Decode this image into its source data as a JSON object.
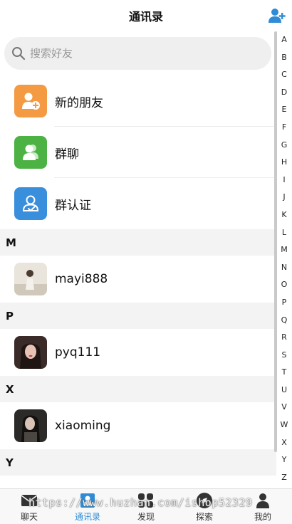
{
  "header": {
    "title": "通讯录"
  },
  "search": {
    "placeholder": "搜索好友"
  },
  "functions": [
    {
      "label": "新的朋友",
      "color": "#f39a42",
      "icon": "new-friend-icon"
    },
    {
      "label": "群聊",
      "color": "#4cb244",
      "icon": "group-chat-icon"
    },
    {
      "label": "群认证",
      "color": "#3a8fdc",
      "icon": "group-verify-icon"
    }
  ],
  "sections": [
    {
      "letter": "M",
      "contacts": [
        {
          "name": "mayi888"
        }
      ]
    },
    {
      "letter": "P",
      "contacts": [
        {
          "name": "pyq111"
        }
      ]
    },
    {
      "letter": "X",
      "contacts": [
        {
          "name": "xiaoming"
        }
      ]
    },
    {
      "letter": "Y",
      "contacts": []
    }
  ],
  "index_letters": [
    "A",
    "B",
    "C",
    "D",
    "E",
    "F",
    "G",
    "H",
    "I",
    "J",
    "K",
    "L",
    "M",
    "N",
    "O",
    "P",
    "Q",
    "R",
    "S",
    "T",
    "U",
    "V",
    "W",
    "X",
    "Y",
    "Z"
  ],
  "tabs": [
    {
      "label": "聊天",
      "icon": "chat-icon"
    },
    {
      "label": "通讯录",
      "icon": "contacts-icon",
      "active": true
    },
    {
      "label": "发现",
      "icon": "discover-icon"
    },
    {
      "label": "探索",
      "icon": "explore-icon"
    },
    {
      "label": "我的",
      "icon": "profile-icon"
    }
  ],
  "colors": {
    "accent": "#2f8bd5",
    "section_bg": "#f3f3f3",
    "search_bg": "#efefef"
  },
  "watermark": "https://www.huzhan.com/ishop52329"
}
